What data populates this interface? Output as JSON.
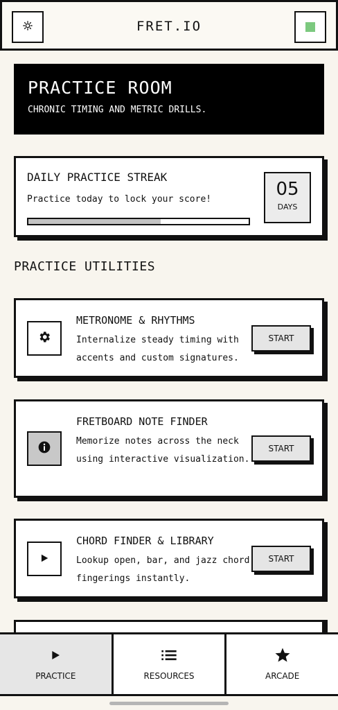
{
  "header": {
    "title": "FRET.IO",
    "left_icon": "gear-icon",
    "right_icon": "square-icon",
    "accent_color": "#7cc97f"
  },
  "hero": {
    "title": "PRACTICE ROOM",
    "subtitle": "CHRONIC TIMING AND METRIC DRILLS."
  },
  "streak": {
    "title": "DAILY PRACTICE STREAK",
    "subtitle": "Practice today to lock your score!",
    "progress_percent": 60,
    "days_value": "05",
    "days_label": "DAYS"
  },
  "utilities": {
    "section_title": "PRACTICE UTILITIES",
    "items": [
      {
        "title": "METRONOME & RHYTHMS",
        "description": "Internalize steady timing with accents and custom signatures.",
        "icon": "gear-icon",
        "button": "START"
      },
      {
        "title": "FRETBOARD NOTE FINDER",
        "description": "Memorize notes across the neck using interactive visualization.",
        "icon": "info-icon",
        "button": "START"
      },
      {
        "title": "CHORD FINDER & LIBRARY",
        "description": "Lookup open, bar, and jazz chord fingerings instantly.",
        "icon": "play-icon",
        "button": "START"
      }
    ]
  },
  "nav": {
    "items": [
      {
        "label": "PRACTICE",
        "icon": "play-icon",
        "active": true
      },
      {
        "label": "RESOURCES",
        "icon": "list-icon",
        "active": false
      },
      {
        "label": "ARCADE",
        "icon": "star-icon",
        "active": false
      }
    ]
  }
}
